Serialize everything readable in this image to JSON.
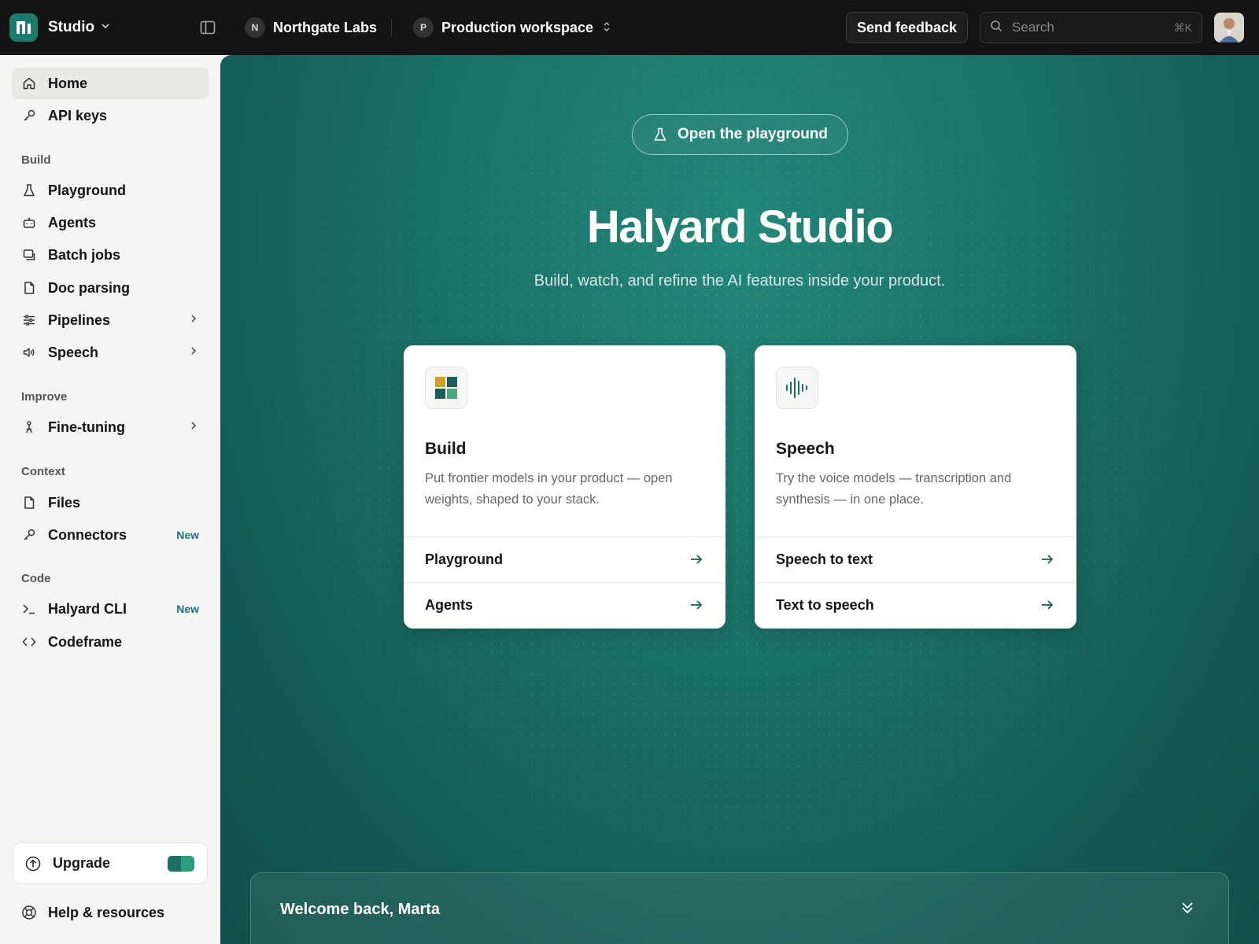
{
  "topbar": {
    "app_name": "Studio",
    "org": {
      "badge": "N",
      "name": "Northgate Labs"
    },
    "project": {
      "badge": "P",
      "name": "Production workspace"
    },
    "feedback_label": "Send feedback",
    "search": {
      "placeholder": "Search",
      "shortcut": "⌘K"
    }
  },
  "sidebar": {
    "top_items": [
      {
        "label": "Home",
        "icon": "home-icon",
        "active": true
      },
      {
        "label": "API keys",
        "icon": "key-icon"
      }
    ],
    "sections": [
      {
        "label": "Build",
        "items": [
          {
            "label": "Playground",
            "icon": "flask-icon"
          },
          {
            "label": "Agents",
            "icon": "robot-icon"
          },
          {
            "label": "Batch jobs",
            "icon": "batch-icon"
          },
          {
            "label": "Doc parsing",
            "icon": "document-icon"
          },
          {
            "label": "Pipelines",
            "icon": "sliders-icon",
            "expandable": true
          },
          {
            "label": "Speech",
            "icon": "speaker-icon",
            "expandable": true
          }
        ]
      },
      {
        "label": "Improve",
        "items": [
          {
            "label": "Fine-tuning",
            "icon": "tuning-icon",
            "expandable": true
          }
        ]
      },
      {
        "label": "Context",
        "items": [
          {
            "label": "Files",
            "icon": "file-icon"
          },
          {
            "label": "Connectors",
            "icon": "key-icon",
            "badge": "New"
          }
        ]
      },
      {
        "label": "Code",
        "items": [
          {
            "label": "Halyard CLI",
            "icon": "terminal-icon",
            "badge": "New"
          },
          {
            "label": "Codeframe",
            "icon": "code-icon"
          }
        ]
      }
    ],
    "upgrade_label": "Upgrade",
    "help_label": "Help & resources"
  },
  "main": {
    "pill_label": "Open the playground",
    "title": "Halyard Studio",
    "subtitle": "Build, watch, and refine the AI features inside your product.",
    "cards": [
      {
        "title": "Build",
        "description": "Put frontier models in your product — open weights, shaped to your stack.",
        "links": [
          "Playground",
          "Agents"
        ],
        "icon": "grid-blocks-icon"
      },
      {
        "title": "Speech",
        "description": "Try the voice models — transcription and synthesis — in one place.",
        "links": [
          "Speech to text",
          "Text to speech"
        ],
        "icon": "waveform-icon"
      }
    ],
    "welcome": "Welcome back, Marta"
  },
  "colors": {
    "accent": "#1d7a6e",
    "topbar": "#141414",
    "sidebar": "#f5f5f3",
    "new_badge": "#1d6e8a"
  }
}
